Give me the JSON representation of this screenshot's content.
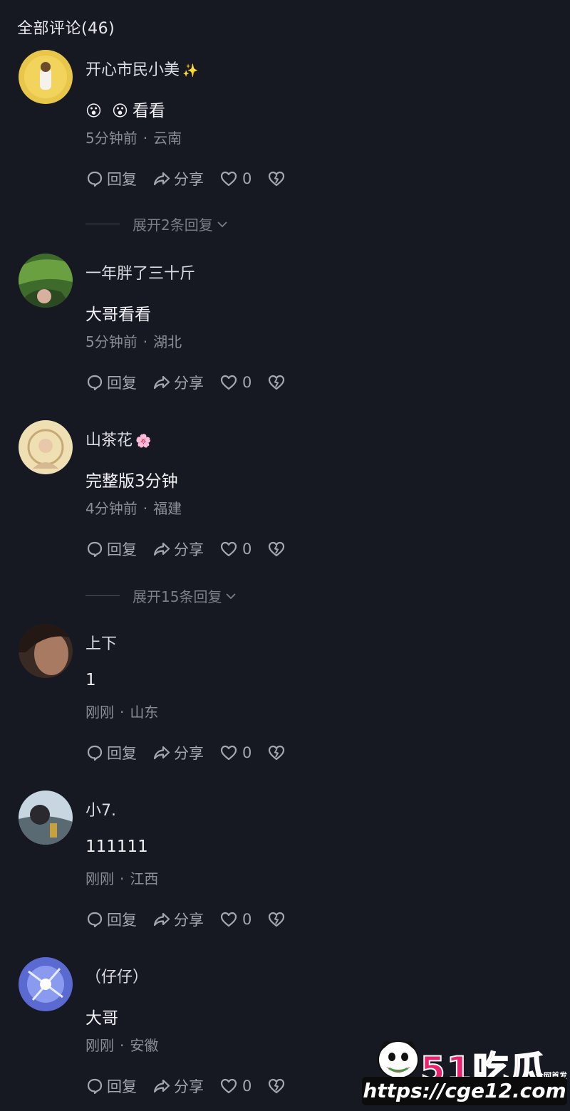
{
  "header": {
    "title": "全部评论(46)"
  },
  "labels": {
    "reply": "回复",
    "share": "分享",
    "dot": "·"
  },
  "comments": [
    {
      "username": "开心市民小美",
      "name_deco": "✨",
      "emojis": [
        "😮",
        "😮"
      ],
      "text": "看看",
      "time": "5分钟前",
      "location": "云南",
      "likes": "0",
      "expand": "展开2条回复"
    },
    {
      "username": "一年胖了三十斤",
      "text": "大哥看看",
      "time": "5分钟前",
      "location": "湖北",
      "likes": "0"
    },
    {
      "username": "山茶花",
      "name_deco": "🌸",
      "text": "完整版3分钟",
      "time": "4分钟前",
      "location": "福建",
      "likes": "0",
      "expand": "展开15条回复"
    },
    {
      "username": "上下",
      "text": "1",
      "time": "刚刚",
      "location": "山东",
      "likes": "0"
    },
    {
      "username": "小7.",
      "text": "111111",
      "time": "刚刚",
      "location": "江西",
      "likes": "0"
    },
    {
      "username": "（仔仔）",
      "text": "大哥",
      "time": "刚刚",
      "location": "安徽",
      "likes": "0"
    }
  ],
  "watermark": {
    "logo": "51吃瓜",
    "tag": "全网首发",
    "url": "https://cge12.com"
  }
}
